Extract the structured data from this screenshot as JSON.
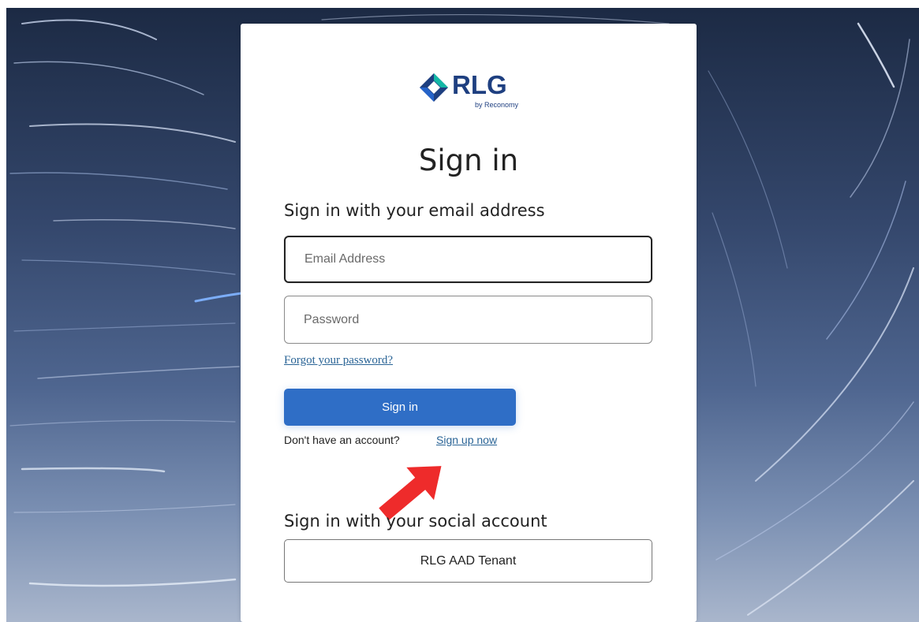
{
  "brand": {
    "name": "RLG",
    "tagline": "by Reconomy",
    "colors": {
      "navy": "#1e3f80",
      "teal": "#14b8a6",
      "blue": "#2563c9"
    }
  },
  "form": {
    "title": "Sign in",
    "email_section_heading": "Sign in with your email address",
    "email_placeholder": "Email Address",
    "email_value": "",
    "password_placeholder": "Password",
    "password_value": "",
    "forgot_link": "Forgot your password?",
    "submit_label": "Sign in",
    "no_account_text": "Don't have an account?",
    "signup_link": "Sign up now"
  },
  "social": {
    "heading": "Sign in with your social account",
    "provider_button": "RLG AAD Tenant"
  },
  "annotation": {
    "arrow_color": "#ee2b2b"
  },
  "theme": {
    "primary_button": "#2f6ec6",
    "link": "#2a6496"
  }
}
